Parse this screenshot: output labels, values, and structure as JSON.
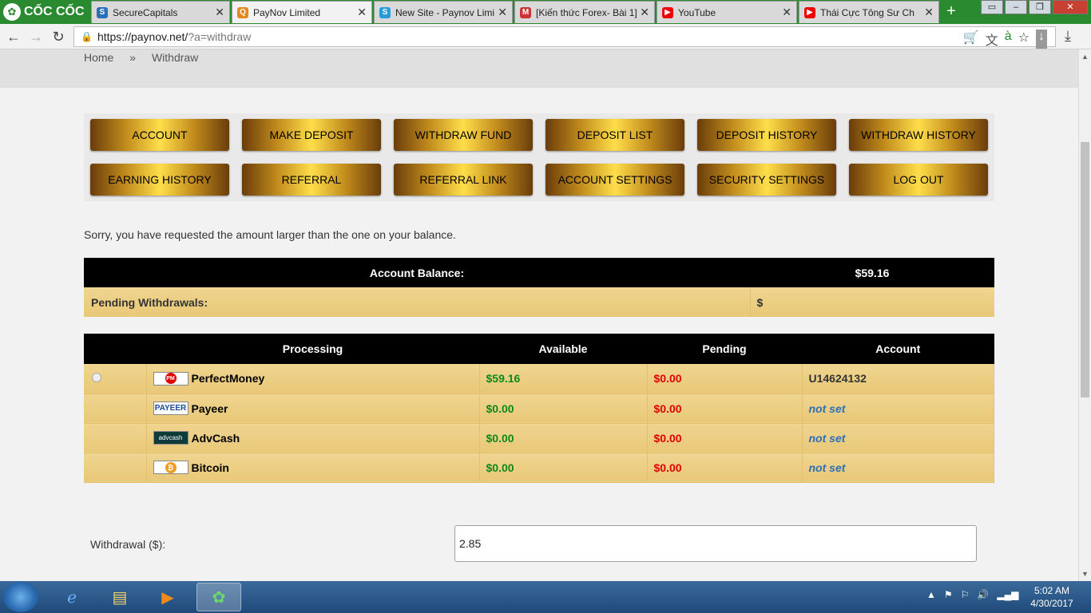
{
  "browser": {
    "brand": "CỐC CỐC",
    "tabs": [
      {
        "title": "SecureCapitals",
        "color": "#2a6fb8",
        "glyph": "S"
      },
      {
        "title": "PayNov Limited",
        "color": "#e38a1c",
        "glyph": "Q"
      },
      {
        "title": "New Site - Paynov Limi",
        "color": "#2a9ad8",
        "glyph": "S"
      },
      {
        "title": "[Kiến thức Forex- Bài 1]",
        "color": "#c33",
        "glyph": "M"
      },
      {
        "title": "YouTube",
        "color": "#e00",
        "glyph": "▶"
      },
      {
        "title": "Thái Cực Tông Sư Ch",
        "color": "#e00",
        "glyph": "▶"
      }
    ],
    "url_host": "https://paynov.net/",
    "url_path": "?a=withdraw"
  },
  "breadcrumb": {
    "home": "Home",
    "sep": "»",
    "current": "Withdraw"
  },
  "menu": [
    "ACCOUNT",
    "MAKE DEPOSIT",
    "WITHDRAW FUND",
    "DEPOSIT LIST",
    "DEPOSIT HISTORY",
    "WITHDRAW HISTORY",
    "EARNING HISTORY",
    "REFERRAL",
    "REFERRAL LINK",
    "ACCOUNT SETTINGS",
    "SECURITY SETTINGS",
    "LOG OUT"
  ],
  "message": "Sorry, you have requested the amount larger than the one on your balance.",
  "balance": {
    "label": "Account Balance:",
    "value": "$59.16",
    "pending_label": "Pending Withdrawals:",
    "pending_value": "$"
  },
  "processors": {
    "headers": {
      "processing": "Processing",
      "available": "Available",
      "pending": "Pending",
      "account": "Account"
    },
    "rows": [
      {
        "name": "PerfectMoney",
        "logo": "PM",
        "available": "$59.16",
        "pending": "$0.00",
        "account": "U14624132",
        "set": true
      },
      {
        "name": "Payeer",
        "logo": "PAYEER",
        "available": "$0.00",
        "pending": "$0.00",
        "account": "not set",
        "set": false
      },
      {
        "name": "AdvCash",
        "logo": "advcash",
        "available": "$0.00",
        "pending": "$0.00",
        "account": "not set",
        "set": false
      },
      {
        "name": "Bitcoin",
        "logo": "₿",
        "available": "$0.00",
        "pending": "$0.00",
        "account": "not set",
        "set": false
      }
    ]
  },
  "withdrawal": {
    "label": "Withdrawal ($):",
    "value": "2.85"
  },
  "taskbar": {
    "time": "5:02 AM",
    "date": "4/30/2017"
  }
}
